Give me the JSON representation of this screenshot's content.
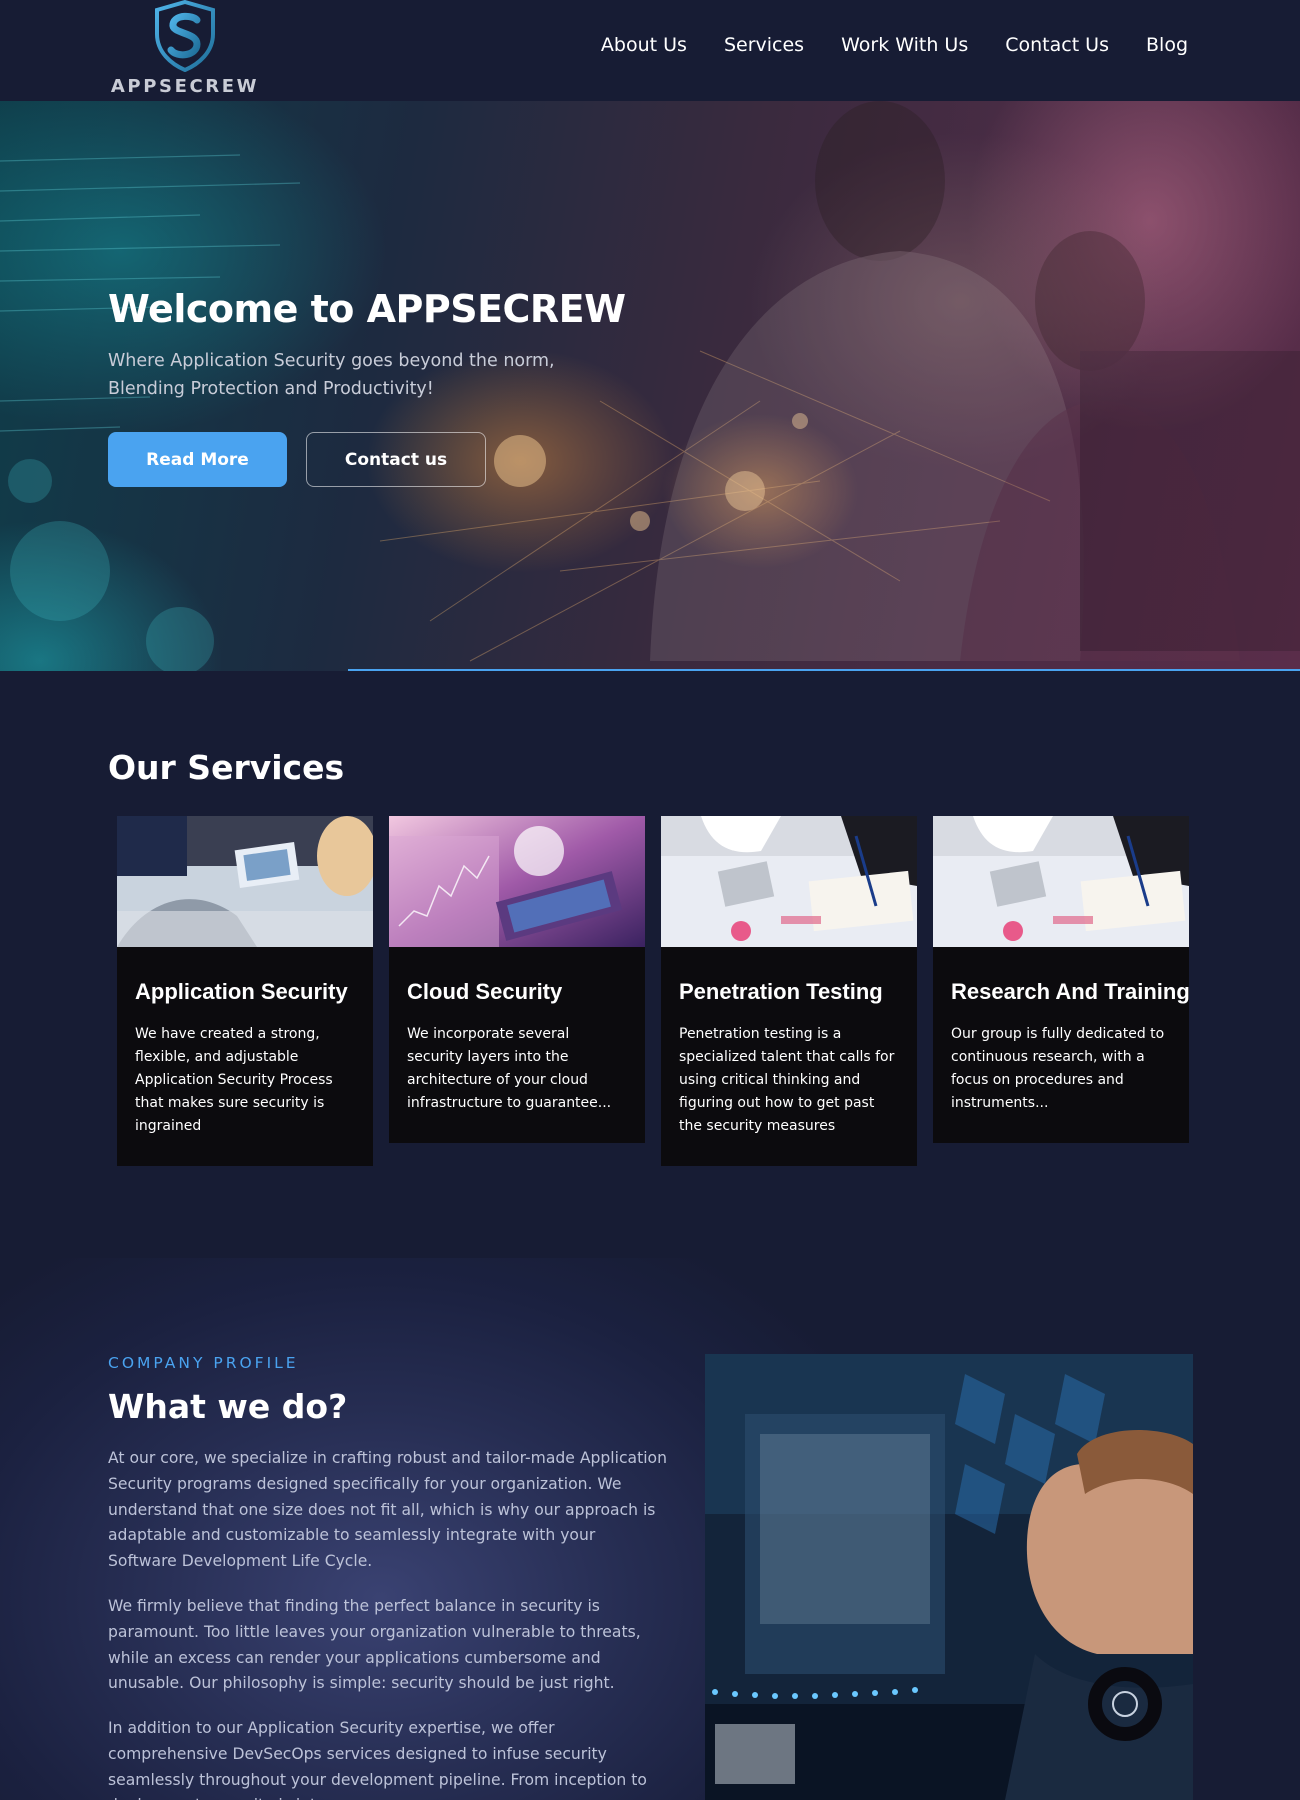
{
  "brand": {
    "name": "APPSECREW",
    "logo_letter": "S",
    "colors": {
      "accent": "#4aa3f0",
      "background": "#171c34",
      "card": "#0c0b0e"
    }
  },
  "nav": {
    "items": [
      {
        "label": "About Us"
      },
      {
        "label": "Services"
      },
      {
        "label": "Work With Us"
      },
      {
        "label": "Contact Us"
      },
      {
        "label": "Blog"
      }
    ]
  },
  "hero": {
    "title": "Welcome to APPSECREW",
    "subtitle": "Where Application Security goes beyond the norm, Blending Protection and Productivity!",
    "primary_button": "Read More",
    "secondary_button": "Contact us"
  },
  "services": {
    "title": "Our Services",
    "cards": [
      {
        "title": "Application Security",
        "description": "We have created a strong, flexible, and adjustable Application Security Process that makes sure security is ingrained"
      },
      {
        "title": "Cloud Security",
        "description": "We incorporate several security layers into the architecture of your cloud infrastructure to guarantee..."
      },
      {
        "title": "Penetration Testing",
        "description": "Penetration testing is a specialized talent that calls for using critical thinking and figuring out how to get past the security measures"
      },
      {
        "title": "Research And Training",
        "description": "Our group is fully dedicated to continuous research, with a focus on procedures and instruments..."
      }
    ]
  },
  "profile": {
    "eyebrow": "COMPANY PROFILE",
    "title": "What we do?",
    "paragraphs": [
      "At our core, we specialize in crafting robust and tailor-made Application Security programs designed specifically for your organization. We understand that one size does not fit all, which is why our approach is adaptable and customizable to seamlessly integrate with your Software Development Life Cycle.",
      "We firmly believe that finding the perfect balance in security is paramount. Too little leaves your organization vulnerable to threats, while an excess can render your applications cumbersome and unusable. Our philosophy is simple: security should be just right.",
      "In addition to our Application Security expertise, we offer comprehensive DevSecOps services designed to infuse security seamlessly throughout your development pipeline. From inception to deployment, security is interwoven"
    ]
  }
}
